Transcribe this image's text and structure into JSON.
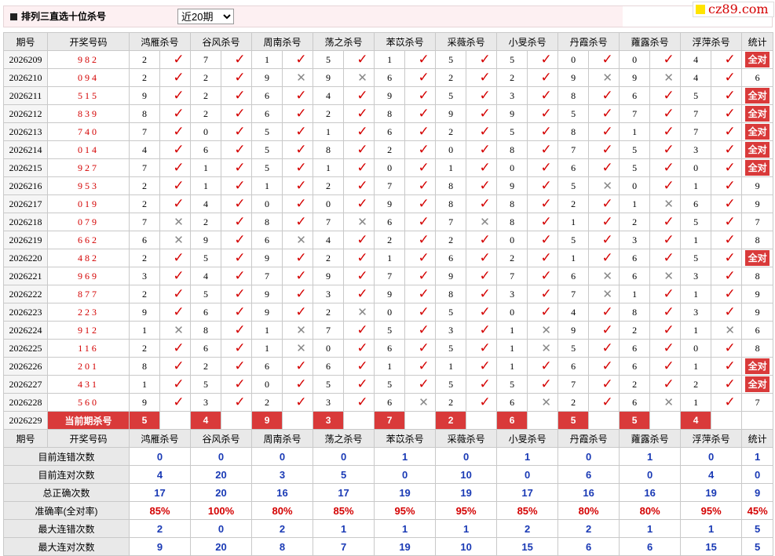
{
  "header": {
    "title": "排列三直选十位杀号",
    "period_select": "近20期",
    "logo": "cz89.com"
  },
  "columns": {
    "period": "期号",
    "draw": "开奖号码",
    "experts": [
      "鸿雁杀号",
      "谷风杀号",
      "周南杀号",
      "荡之杀号",
      "苯苡杀号",
      "采薇杀号",
      "小旻杀号",
      "丹霞杀号",
      "蕹露杀号",
      "浮萍杀号"
    ],
    "stat": "统计"
  },
  "rows": [
    {
      "period": "2026209",
      "draw": "982",
      "kills": [
        "2",
        "7",
        "1",
        "5",
        "1",
        "5",
        "5",
        "0",
        "0",
        "4"
      ],
      "hits": [
        1,
        1,
        1,
        1,
        1,
        1,
        1,
        1,
        1,
        1
      ],
      "stat": "全对"
    },
    {
      "period": "2026210",
      "draw": "094",
      "kills": [
        "2",
        "2",
        "9",
        "9",
        "6",
        "2",
        "2",
        "9",
        "9",
        "4"
      ],
      "hits": [
        1,
        1,
        0,
        0,
        1,
        1,
        1,
        0,
        0,
        1
      ],
      "stat": "6"
    },
    {
      "period": "2026211",
      "draw": "515",
      "kills": [
        "9",
        "2",
        "6",
        "4",
        "9",
        "5",
        "3",
        "8",
        "6",
        "5"
      ],
      "hits": [
        1,
        1,
        1,
        1,
        1,
        1,
        1,
        1,
        1,
        1
      ],
      "stat": "全对"
    },
    {
      "period": "2026212",
      "draw": "839",
      "kills": [
        "8",
        "2",
        "6",
        "2",
        "8",
        "9",
        "9",
        "5",
        "7",
        "7"
      ],
      "hits": [
        1,
        1,
        1,
        1,
        1,
        1,
        1,
        1,
        1,
        1
      ],
      "stat": "全对"
    },
    {
      "period": "2026213",
      "draw": "740",
      "kills": [
        "7",
        "0",
        "5",
        "1",
        "6",
        "2",
        "5",
        "8",
        "1",
        "7"
      ],
      "hits": [
        1,
        1,
        1,
        1,
        1,
        1,
        1,
        1,
        1,
        1
      ],
      "stat": "全对"
    },
    {
      "period": "2026214",
      "draw": "014",
      "kills": [
        "4",
        "6",
        "5",
        "8",
        "2",
        "0",
        "8",
        "7",
        "5",
        "3"
      ],
      "hits": [
        1,
        1,
        1,
        1,
        1,
        1,
        1,
        1,
        1,
        1
      ],
      "stat": "全对"
    },
    {
      "period": "2026215",
      "draw": "927",
      "kills": [
        "7",
        "1",
        "5",
        "1",
        "0",
        "1",
        "0",
        "6",
        "5",
        "0"
      ],
      "hits": [
        1,
        1,
        1,
        1,
        1,
        1,
        1,
        1,
        1,
        1
      ],
      "stat": "全对"
    },
    {
      "period": "2026216",
      "draw": "953",
      "kills": [
        "2",
        "1",
        "1",
        "2",
        "7",
        "8",
        "9",
        "5",
        "0",
        "1"
      ],
      "hits": [
        1,
        1,
        1,
        1,
        1,
        1,
        1,
        0,
        1,
        1
      ],
      "stat": "9"
    },
    {
      "period": "2026217",
      "draw": "019",
      "kills": [
        "2",
        "4",
        "0",
        "0",
        "9",
        "8",
        "8",
        "2",
        "1",
        "6"
      ],
      "hits": [
        1,
        1,
        1,
        1,
        1,
        1,
        1,
        1,
        0,
        1
      ],
      "stat": "9"
    },
    {
      "period": "2026218",
      "draw": "079",
      "kills": [
        "7",
        "2",
        "8",
        "7",
        "6",
        "7",
        "8",
        "1",
        "2",
        "5"
      ],
      "hits": [
        0,
        1,
        1,
        0,
        1,
        0,
        1,
        1,
        1,
        1
      ],
      "stat": "7"
    },
    {
      "period": "2026219",
      "draw": "662",
      "kills": [
        "6",
        "9",
        "6",
        "4",
        "2",
        "2",
        "0",
        "5",
        "3",
        "1"
      ],
      "hits": [
        0,
        1,
        0,
        1,
        1,
        1,
        1,
        1,
        1,
        1
      ],
      "stat": "8"
    },
    {
      "period": "2026220",
      "draw": "482",
      "kills": [
        "2",
        "5",
        "9",
        "2",
        "1",
        "6",
        "2",
        "1",
        "6",
        "5"
      ],
      "hits": [
        1,
        1,
        1,
        1,
        1,
        1,
        1,
        1,
        1,
        1
      ],
      "stat": "全对"
    },
    {
      "period": "2026221",
      "draw": "969",
      "kills": [
        "3",
        "4",
        "7",
        "9",
        "7",
        "9",
        "7",
        "6",
        "6",
        "3"
      ],
      "hits": [
        1,
        1,
        1,
        1,
        1,
        1,
        1,
        0,
        0,
        1
      ],
      "stat": "8"
    },
    {
      "period": "2026222",
      "draw": "877",
      "kills": [
        "2",
        "5",
        "9",
        "3",
        "9",
        "8",
        "3",
        "7",
        "1",
        "1"
      ],
      "hits": [
        1,
        1,
        1,
        1,
        1,
        1,
        1,
        0,
        1,
        1
      ],
      "stat": "9"
    },
    {
      "period": "2026223",
      "draw": "223",
      "kills": [
        "9",
        "6",
        "9",
        "2",
        "0",
        "5",
        "0",
        "4",
        "8",
        "3"
      ],
      "hits": [
        1,
        1,
        1,
        0,
        1,
        1,
        1,
        1,
        1,
        1
      ],
      "stat": "9"
    },
    {
      "period": "2026224",
      "draw": "912",
      "kills": [
        "1",
        "8",
        "1",
        "7",
        "5",
        "3",
        "1",
        "9",
        "2",
        "1"
      ],
      "hits": [
        0,
        1,
        0,
        1,
        1,
        1,
        0,
        1,
        1,
        0
      ],
      "stat": "6"
    },
    {
      "period": "2026225",
      "draw": "116",
      "kills": [
        "2",
        "6",
        "1",
        "0",
        "6",
        "5",
        "1",
        "5",
        "6",
        "0"
      ],
      "hits": [
        1,
        1,
        0,
        1,
        1,
        1,
        0,
        1,
        1,
        1
      ],
      "stat": "8"
    },
    {
      "period": "2026226",
      "draw": "201",
      "kills": [
        "8",
        "2",
        "6",
        "6",
        "1",
        "1",
        "1",
        "6",
        "6",
        "1"
      ],
      "hits": [
        1,
        1,
        1,
        1,
        1,
        1,
        1,
        1,
        1,
        1
      ],
      "stat": "全对"
    },
    {
      "period": "2026227",
      "draw": "431",
      "kills": [
        "1",
        "5",
        "0",
        "5",
        "5",
        "5",
        "5",
        "7",
        "2",
        "2"
      ],
      "hits": [
        1,
        1,
        1,
        1,
        1,
        1,
        1,
        1,
        1,
        1
      ],
      "stat": "全对"
    },
    {
      "period": "2026228",
      "draw": "560",
      "kills": [
        "9",
        "3",
        "2",
        "3",
        "6",
        "2",
        "6",
        "2",
        "6",
        "1"
      ],
      "hits": [
        1,
        1,
        1,
        1,
        0,
        1,
        0,
        1,
        0,
        1
      ],
      "stat": "7"
    }
  ],
  "current": {
    "period": "2026229",
    "label": "当前期杀号",
    "kills": [
      "5",
      "4",
      "9",
      "3",
      "7",
      "2",
      "6",
      "5",
      "5",
      "4"
    ]
  },
  "stats": [
    {
      "label": "目前连错次数",
      "values": [
        "0",
        "0",
        "0",
        "0",
        "1",
        "0",
        "1",
        "0",
        "1",
        "0"
      ],
      "total": "1",
      "red": false
    },
    {
      "label": "目前连对次数",
      "values": [
        "4",
        "20",
        "3",
        "5",
        "0",
        "10",
        "0",
        "6",
        "0",
        "4"
      ],
      "total": "0",
      "red": false
    },
    {
      "label": "总正确次数",
      "values": [
        "17",
        "20",
        "16",
        "17",
        "19",
        "19",
        "17",
        "16",
        "16",
        "19"
      ],
      "total": "9",
      "red": false
    },
    {
      "label": "准确率(全对率)",
      "values": [
        "85%",
        "100%",
        "80%",
        "85%",
        "95%",
        "95%",
        "85%",
        "80%",
        "80%",
        "95%"
      ],
      "total": "45%",
      "red": true
    },
    {
      "label": "最大连错次数",
      "values": [
        "2",
        "0",
        "2",
        "1",
        "1",
        "1",
        "2",
        "2",
        "1",
        "1"
      ],
      "total": "5",
      "red": false
    },
    {
      "label": "最大连对次数",
      "values": [
        "9",
        "20",
        "8",
        "7",
        "19",
        "10",
        "15",
        "6",
        "6",
        "15"
      ],
      "total": "5",
      "red": false
    }
  ]
}
